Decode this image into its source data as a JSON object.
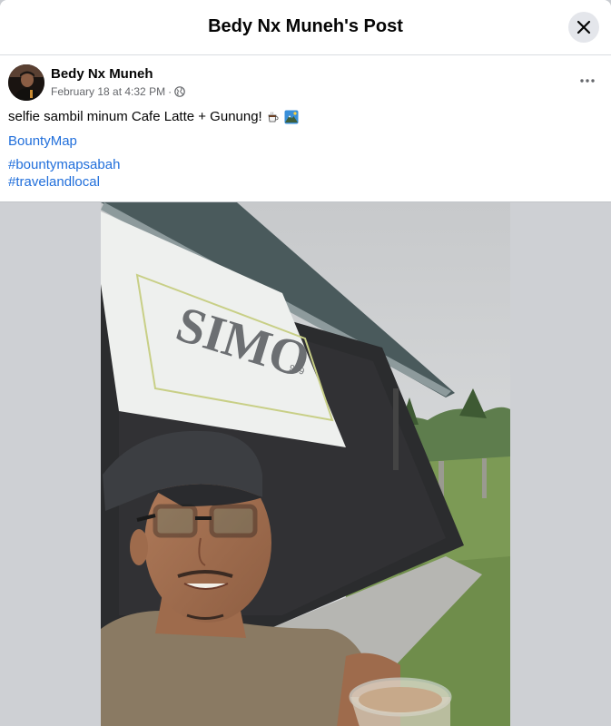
{
  "header": {
    "title": "Bedy Nx Muneh's Post"
  },
  "post": {
    "author": "Bedy Nx Muneh",
    "timestamp": "February 18 at 4:32 PM",
    "separator": "·",
    "audience_icon": "globe-icon",
    "text": "selfie sambil minum Cafe Latte + Gunung!",
    "emojis": [
      "coffee-emoji",
      "mountain-emoji"
    ],
    "links": [
      "BountyMap",
      "#bountymapsabah",
      "#travelandlocal"
    ]
  },
  "photo": {
    "banner_text": "SIMO",
    "banner_badge": "999"
  },
  "colors": {
    "link": "#216fdb",
    "meta": "#65676b",
    "backdrop": "#ced0d4"
  }
}
